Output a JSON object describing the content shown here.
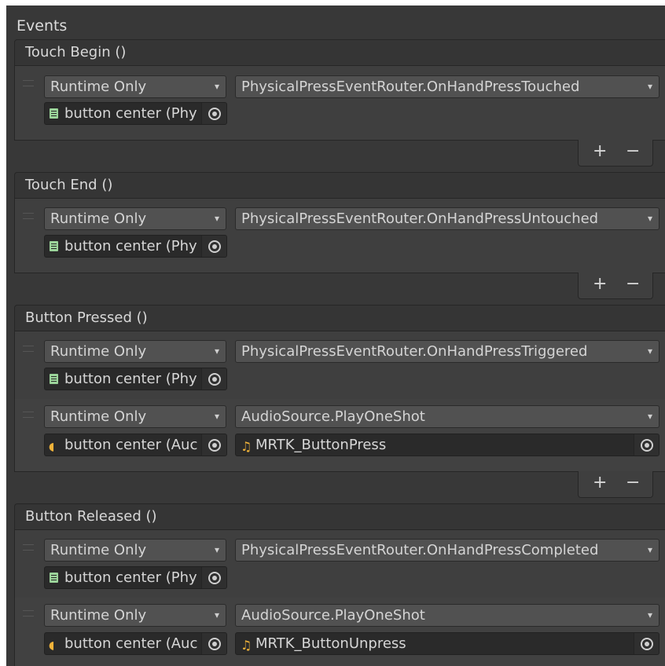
{
  "title": "Events",
  "sections": [
    {
      "header": "Touch Begin ()",
      "rows": [
        {
          "mode": "Runtime Only",
          "function": "PhysicalPressEventRouter.OnHandPressTouched",
          "target": "button center (Phy",
          "target_icon": "script-icon"
        }
      ]
    },
    {
      "header": "Touch End ()",
      "rows": [
        {
          "mode": "Runtime Only",
          "function": "PhysicalPressEventRouter.OnHandPressUntouched",
          "target": "button center (Phy",
          "target_icon": "script-icon"
        }
      ]
    },
    {
      "header": "Button Pressed ()",
      "rows": [
        {
          "mode": "Runtime Only",
          "function": "PhysicalPressEventRouter.OnHandPressTriggered",
          "target": "button center (Phy",
          "target_icon": "script-icon"
        },
        {
          "mode": "Runtime Only",
          "function": "AudioSource.PlayOneShot",
          "target": "button center (Auc",
          "target_icon": "audio-source-icon",
          "argument": "MRTK_ButtonPress",
          "argument_icon": "audio-clip-icon"
        }
      ]
    },
    {
      "header": "Button Released ()",
      "rows": [
        {
          "mode": "Runtime Only",
          "function": "PhysicalPressEventRouter.OnHandPressCompleted",
          "target": "button center (Phy",
          "target_icon": "script-icon"
        },
        {
          "mode": "Runtime Only",
          "function": "AudioSource.PlayOneShot",
          "target": "button center (Auc",
          "target_icon": "audio-source-icon",
          "argument": "MRTK_ButtonUnpress",
          "argument_icon": "audio-clip-icon"
        }
      ]
    }
  ],
  "footer": {
    "add_label": "+",
    "remove_label": "−"
  },
  "icons": {
    "dropdown": "▾",
    "audio": "◖",
    "note": "♫"
  }
}
